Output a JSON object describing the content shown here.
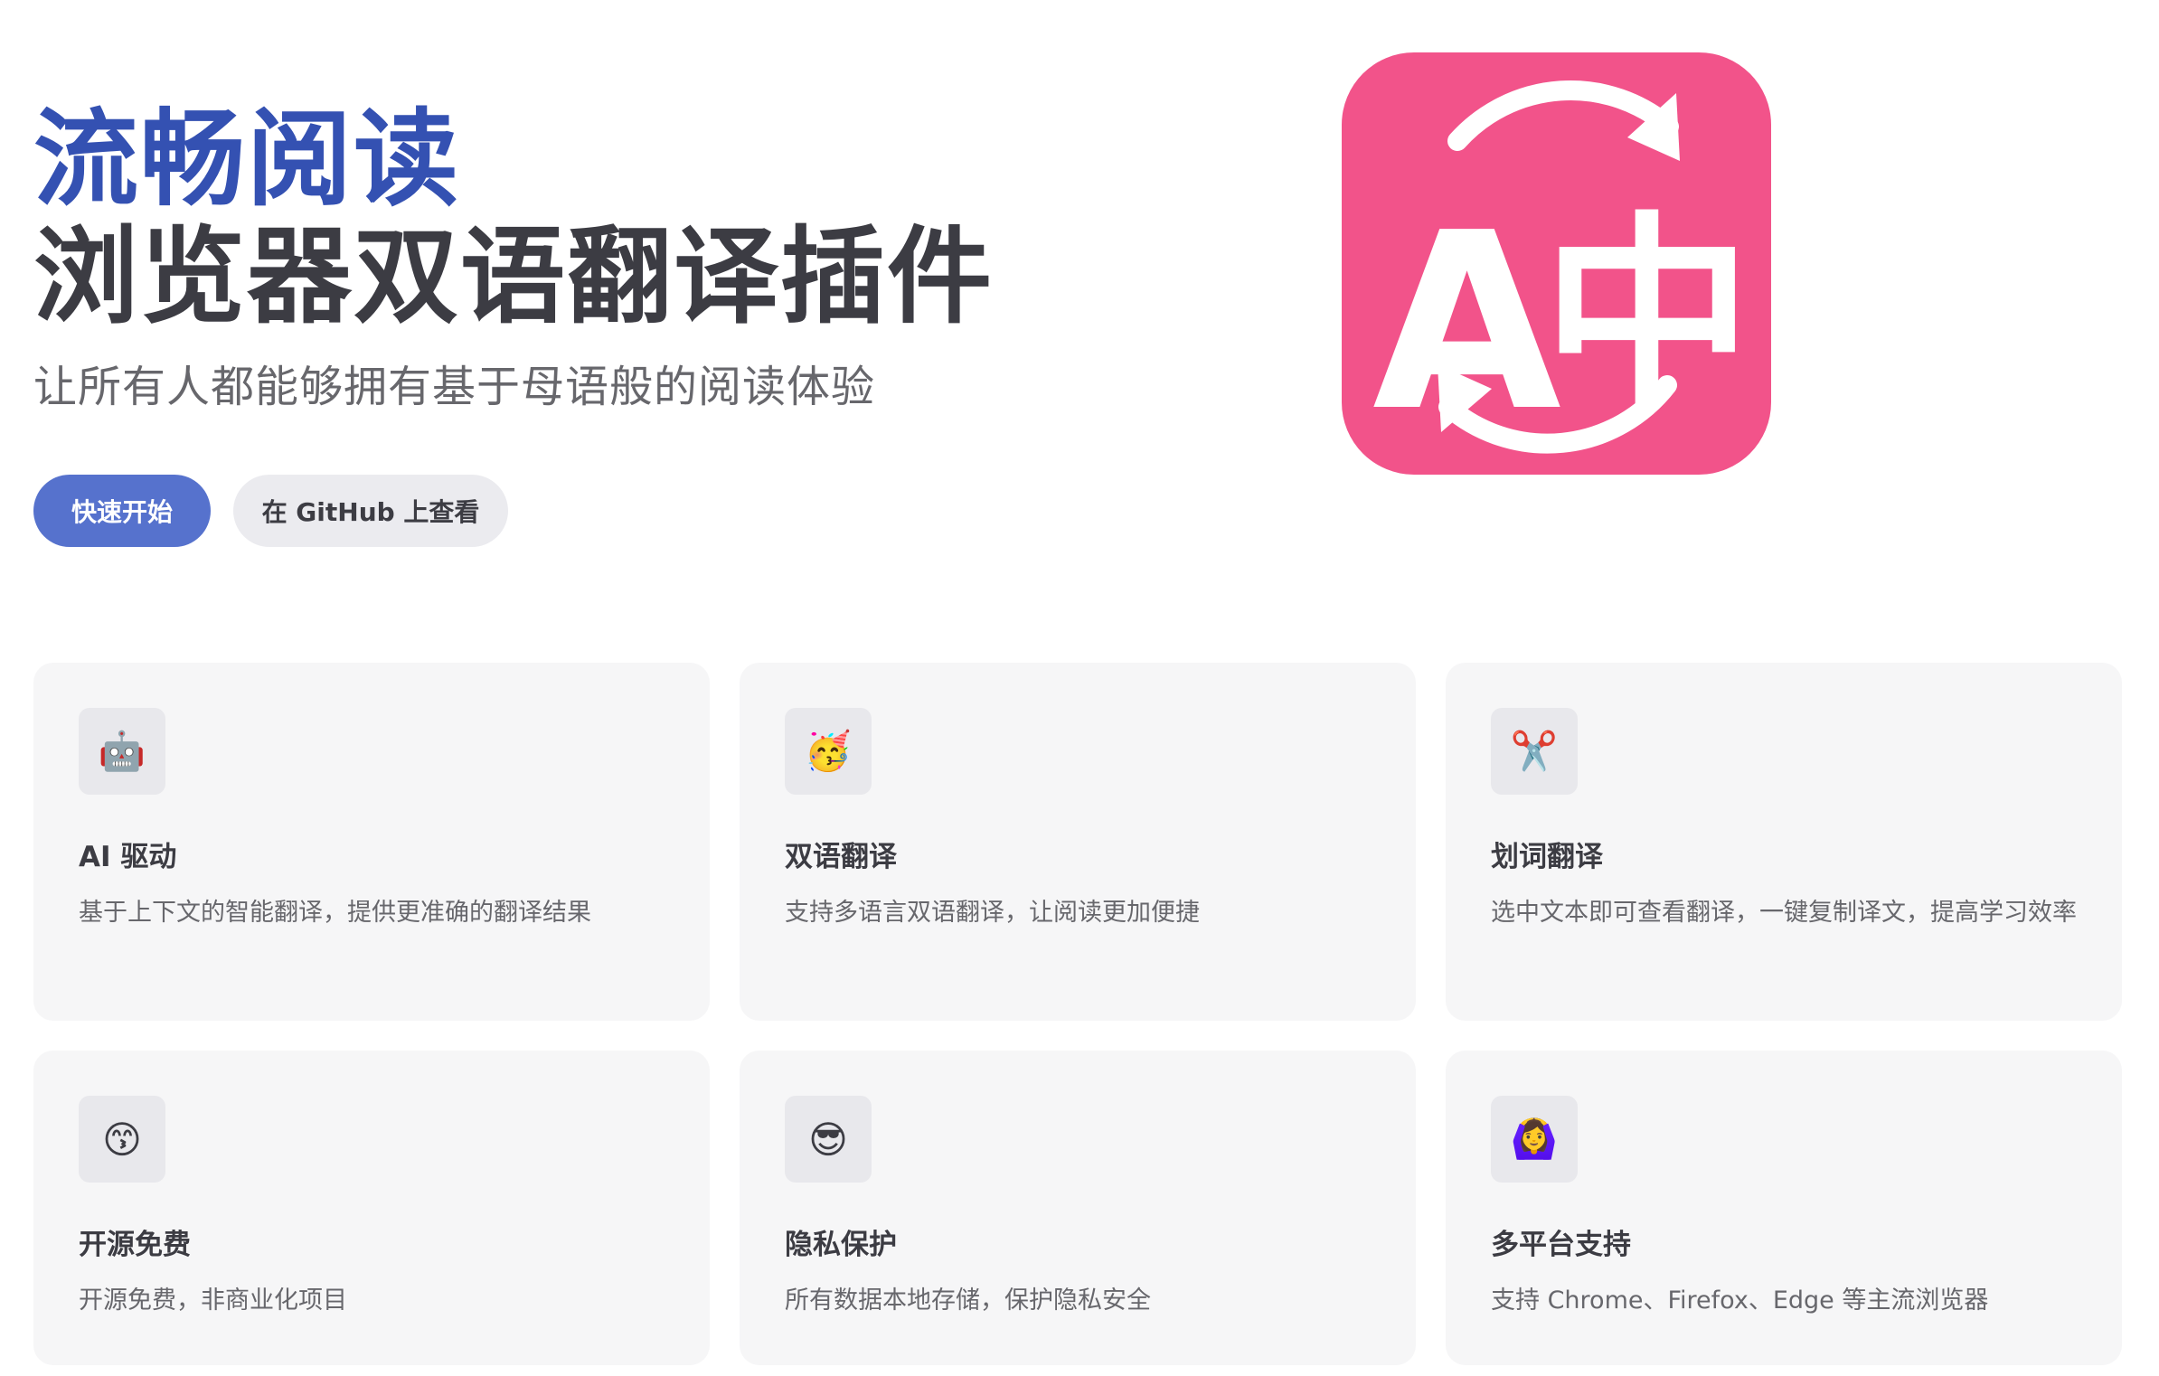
{
  "hero": {
    "brand": "流畅阅读",
    "headline": "浏览器双语翻译插件",
    "tagline": "让所有人都能够拥有基于母语般的阅读体验",
    "primary_action": "快速开始",
    "secondary_action": "在 GitHub 上查看"
  },
  "logo": {
    "latin_glyph": "A",
    "cjk_glyph": "中",
    "icon": "translate-arrows-icon",
    "color": "#f2538a"
  },
  "features": [
    {
      "icon": "🤖",
      "icon_name": "robot-icon",
      "title": "AI 驱动",
      "desc": "基于上下文的智能翻译，提供更准确的翻译结果"
    },
    {
      "icon": "🥳",
      "icon_name": "party-face-icon",
      "title": "双语翻译",
      "desc": "支持多语言双语翻译，让阅读更加便捷"
    },
    {
      "icon": "✂️",
      "icon_name": "scissors-icon",
      "title": "划词翻译",
      "desc": "选中文本即可查看翻译，一键复制译文，提高学习效率"
    },
    {
      "icon": "😙",
      "icon_name": "kissing-face-icon",
      "title": "开源免费",
      "desc": "开源免费，非商业化项目"
    },
    {
      "icon": "😎",
      "icon_name": "sunglasses-face-icon",
      "title": "隐私保护",
      "desc": "所有数据本地存储，保护隐私安全"
    },
    {
      "icon": "🙆‍♀️",
      "icon_name": "person-ok-gesture-icon",
      "title": "多平台支持",
      "desc": "支持 Chrome、Firefox、Edge 等主流浏览器"
    }
  ],
  "colors": {
    "brand": "#3451b2",
    "primary_button": "#5672cd",
    "card_background": "#f6f6f7"
  }
}
